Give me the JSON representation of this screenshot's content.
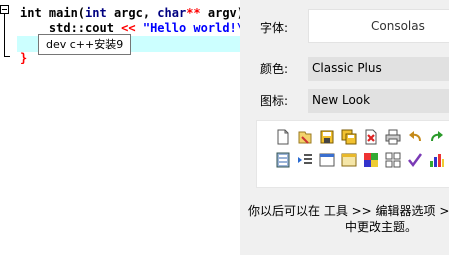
{
  "editor": {
    "lines": [
      {
        "t1": "int main(",
        "t2": "int",
        "t3": " argc, ",
        "t4": "char",
        "t5": "**",
        "t6": " argv)"
      },
      {
        "t1": "    std::cout ",
        "t2": "<<",
        "t3": " ",
        "t4": "\"Hello world!\\"
      },
      {
        "brace": "}"
      }
    ],
    "tooltip": "dev c++安装9"
  },
  "settings": {
    "font_label": "字体:",
    "font_value": "Consolas",
    "color_label": "颜色:",
    "color_value": "Classic Plus",
    "icon_label": "图标:",
    "icon_value": "New Look",
    "hint_line1": "你以后可以在 工具 >> 编辑器选项 >",
    "hint_line2": "中更改主题。"
  },
  "icons": [
    "new-file-icon",
    "open-file-icon",
    "save-icon",
    "save-all-icon",
    "close-file-icon",
    "print-icon",
    "undo-icon",
    "redo-icon",
    "project-icon",
    "indent-icon",
    "window-icon",
    "class-icon",
    "grid-icon",
    "check-icon",
    "chart-icon"
  ]
}
